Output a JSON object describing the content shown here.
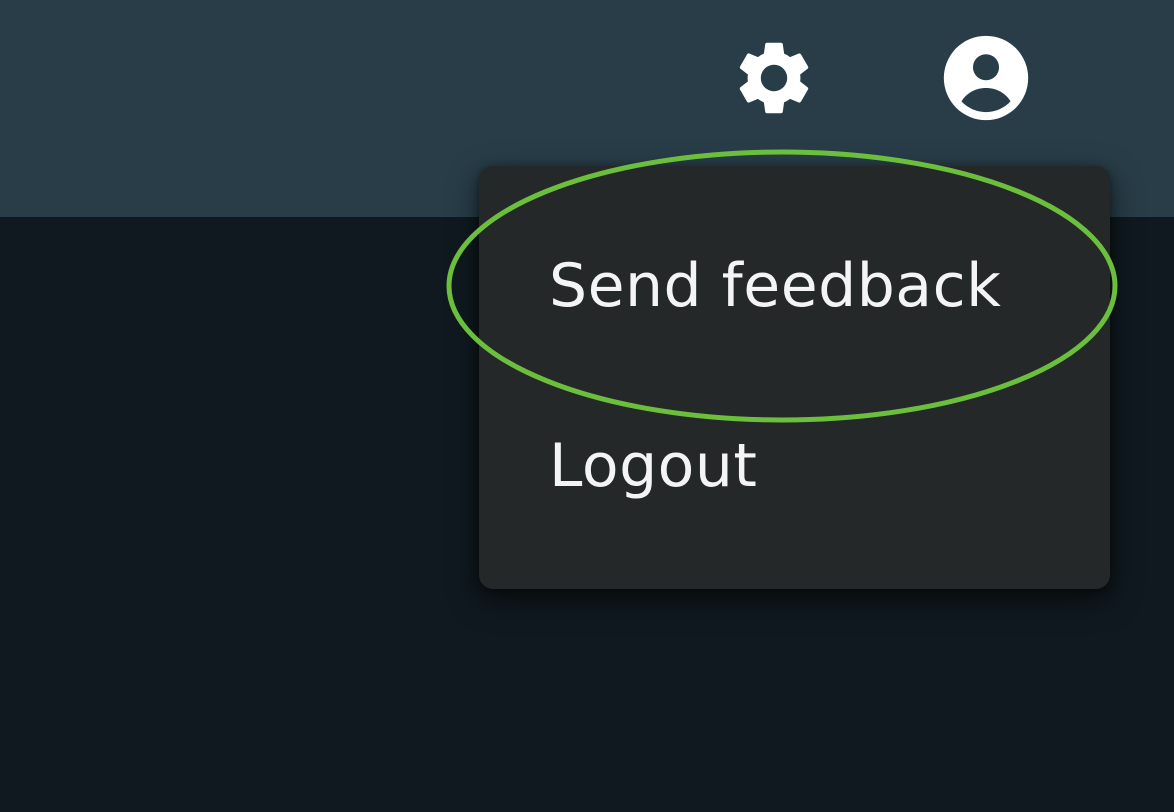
{
  "header": {
    "settings_icon": "gear-icon",
    "account_icon": "account-circle-icon",
    "background": "#283d48"
  },
  "menu": {
    "items": [
      {
        "label": "Send feedback"
      },
      {
        "label": "Logout"
      }
    ],
    "background": "#242829"
  },
  "annotation": {
    "highlight_color": "#6cbf3c"
  },
  "page": {
    "background": "#0f191f"
  }
}
